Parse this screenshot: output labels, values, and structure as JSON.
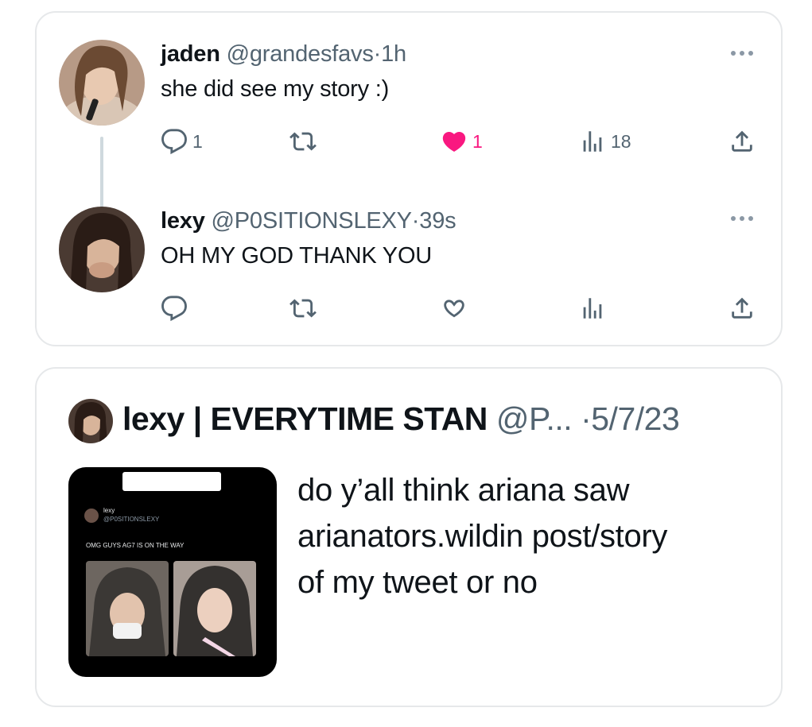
{
  "reply_thread": {
    "tweet_1": {
      "avatar_icon": "profile-photo",
      "name": "jaden",
      "handle": "@grandesfavs",
      "separator": "·",
      "time": "1h",
      "text": "she did see my story :)",
      "more_icon": "ellipsis-icon",
      "actions": {
        "reply_count": "1",
        "retweet_count": "",
        "like_count": "1",
        "liked": true,
        "views_count": "18"
      }
    },
    "tweet_2": {
      "avatar_icon": "profile-photo",
      "name": "lexy",
      "handle": "@P0SITIONSLEXY",
      "separator": "·",
      "time": "39s",
      "text": "OH MY GOD THANK YOU",
      "more_icon": "ellipsis-icon",
      "actions": {
        "reply_count": "",
        "retweet_count": "",
        "like_count": "",
        "liked": false,
        "views_count": ""
      }
    }
  },
  "quoted_tweet": {
    "name": "lexy | EVERYTIME STAN",
    "handle": "@P...",
    "separator": "·",
    "date": "5/7/23",
    "text_lines": [
      "do y’all think ariana saw",
      "arianators.wildin post/story",
      "of my tweet or no"
    ],
    "thumbnail": {
      "inner_name": "lexy",
      "inner_handle": "@P0SITIONSLEXY",
      "inner_text": "OMG GUYS AG7 IS ON THE WAY"
    }
  },
  "colors": {
    "text": "#0f1419",
    "muted": "#536471",
    "like": "#f91880",
    "border": "#e6e8ea"
  }
}
